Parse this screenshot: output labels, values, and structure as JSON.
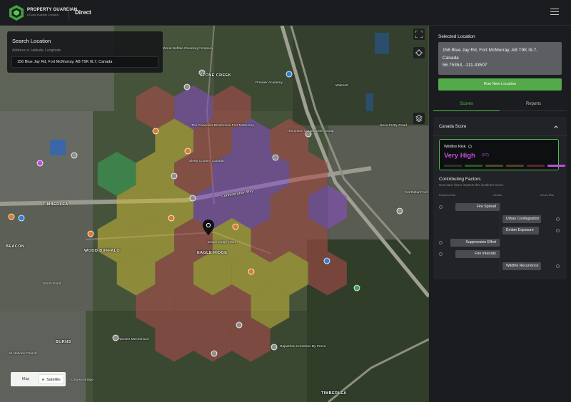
{
  "header": {
    "brand": "PROPERTY GUARDIAN",
    "brand_sub": "A Guard Guardian Company",
    "app_name": "Direct"
  },
  "search": {
    "title": "Search Location",
    "subtitle": "Address or Latitude, Longitude",
    "value": "156 Blue Jay Rd, Fort McMurray, AB T9K 0L7, Canada"
  },
  "map_toggle": {
    "map_label": "Map",
    "satellite_label": "Satellite"
  },
  "map_labels": {
    "timberlea": "TIMBERLEA",
    "beacon": "BEACON",
    "eagle_ridge": "EAGLE RIDGE",
    "wood_buffalo": "WOOD BUFFALO",
    "parsons_creek": "STONE CREEK",
    "burns": "BURNS",
    "timberlea_s": "TIMBERLEA",
    "confederation": "Confederation Way",
    "brett": "Brett Dr",
    "place_1": "Thompson Construction Group",
    "place_2": "Sleep Country Canada",
    "place_3": "The Canadian Brewhouse Fort McMurray",
    "place_4": "Wood Buffalo Cleaning Company",
    "place_5": "Premier Academy",
    "place_6": "Nexsen Mechanical",
    "place_7": "Rajasthan Creations By Purva",
    "place_8": "Grouse Bridge",
    "place_9": "Eagle Ridge Plaza",
    "place_10": "Northstar Ford",
    "place_11": "Nova Pretty Road",
    "place_12": "All Nations Church",
    "place_13": "Storm Pond",
    "place_14": "Walmart"
  },
  "panel": {
    "selected_label": "Selected Location",
    "address_line1": "156 Blue Jay Rd, Fort McMurray, AB T9K 0L7,",
    "address_line2": "Canada",
    "coords": "56.75353, -111.43507",
    "run_button": "Run New Location",
    "tabs": [
      "Scores",
      "Reports"
    ],
    "canada_score": "Canada Score",
    "wildfire": {
      "label": "Wildfire Risk",
      "level": "Very High",
      "score": "(97)",
      "level_index": 5,
      "level_count": 6
    },
    "contributing": {
      "title": "Contributing Factors",
      "subtitle": "How each factor impacts this location's score.",
      "axis": [
        "Reduces Risk",
        "Neutral",
        "Drives Risk"
      ],
      "factors": [
        {
          "name": "Fire Spread",
          "direction": "reduces",
          "magnitude": 0.85
        },
        {
          "name": "Urban Conflagration",
          "direction": "drives",
          "magnitude": 0.74
        },
        {
          "name": "Ember Exposure",
          "direction": "drives",
          "magnitude": 0.7
        },
        {
          "name": "Suppression Effort",
          "direction": "reduces",
          "magnitude": 0.95
        },
        {
          "name": "Fire Intensity",
          "direction": "reduces",
          "magnitude": 0.85
        },
        {
          "name": "Wildfire Recurrence",
          "direction": "drives",
          "magnitude": 0.74
        }
      ]
    }
  },
  "colors": {
    "accent_green": "#54a948",
    "very_high": "#c34de0",
    "hex_yellow": "#c8b83a",
    "hex_red": "#b34c4c",
    "hex_purple": "#8a4fc8",
    "hex_green": "#3aa85a"
  }
}
